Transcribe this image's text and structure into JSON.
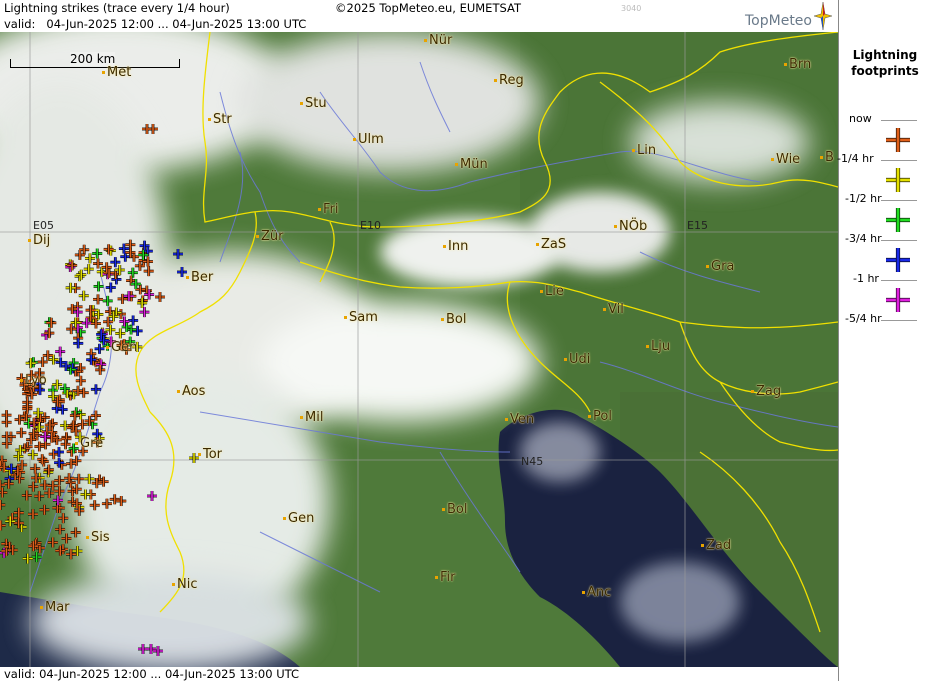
{
  "header": {
    "title": "Lightning strikes (trace every 1/4 hour)",
    "valid_label": "valid:",
    "valid_range": "04-Jun-2025 12:00 ... 04-Jun-2025 13:00 UTC",
    "copyright": "©2025 TopMeteo.eu, EUMETSAT",
    "code": "3040",
    "brand": "TopMeteo"
  },
  "footer": {
    "valid_text": "valid:   04-Jun-2025 12:00 ... 04-Jun-2025 13:00 UTC"
  },
  "scale_bar": {
    "label": "200 km"
  },
  "legend": {
    "title_line1": "Lightning",
    "title_line2": "footprints",
    "items": [
      {
        "label": "now",
        "color": "#e0601a"
      },
      {
        "label": "-1/4 hr",
        "color": "#e4e000"
      },
      {
        "label": "-1/2 hr",
        "color": "#22dd22"
      },
      {
        "label": "-3/4 hr",
        "color": "#1a2ae8"
      },
      {
        "label": "-1 hr",
        "color": "#e020e0"
      },
      {
        "label": "-5/4 hr"
      }
    ]
  },
  "gridlines": {
    "lon": [
      "E05",
      "E10",
      "E15"
    ],
    "lat": [
      "N45"
    ]
  },
  "cities": [
    "Nür",
    "Reg",
    "Brn",
    "Met",
    "Stu",
    "Str",
    "Ulm",
    "Mün",
    "Lin",
    "Wie",
    "B",
    "Fri",
    "Zür",
    "Inn",
    "ZaS",
    "NÖb",
    "Dij",
    "Ber",
    "Gra",
    "Lie",
    "Vil",
    "Sam",
    "Bol",
    "Gen",
    "Lju",
    "Udi",
    "Lyo",
    "Aos",
    "Zag",
    "Mil",
    "Ven",
    "Pol",
    "Tor",
    "Gre",
    "Bol",
    "Gen",
    "Sis",
    "Zad",
    "Fir",
    "Nic",
    "Anc",
    "Mar"
  ],
  "colors": {
    "border": "#f0e000",
    "river": "#6a78d8",
    "sea": "#1a2240",
    "land": "#4f7a3a",
    "cloud": "#ffffff"
  }
}
